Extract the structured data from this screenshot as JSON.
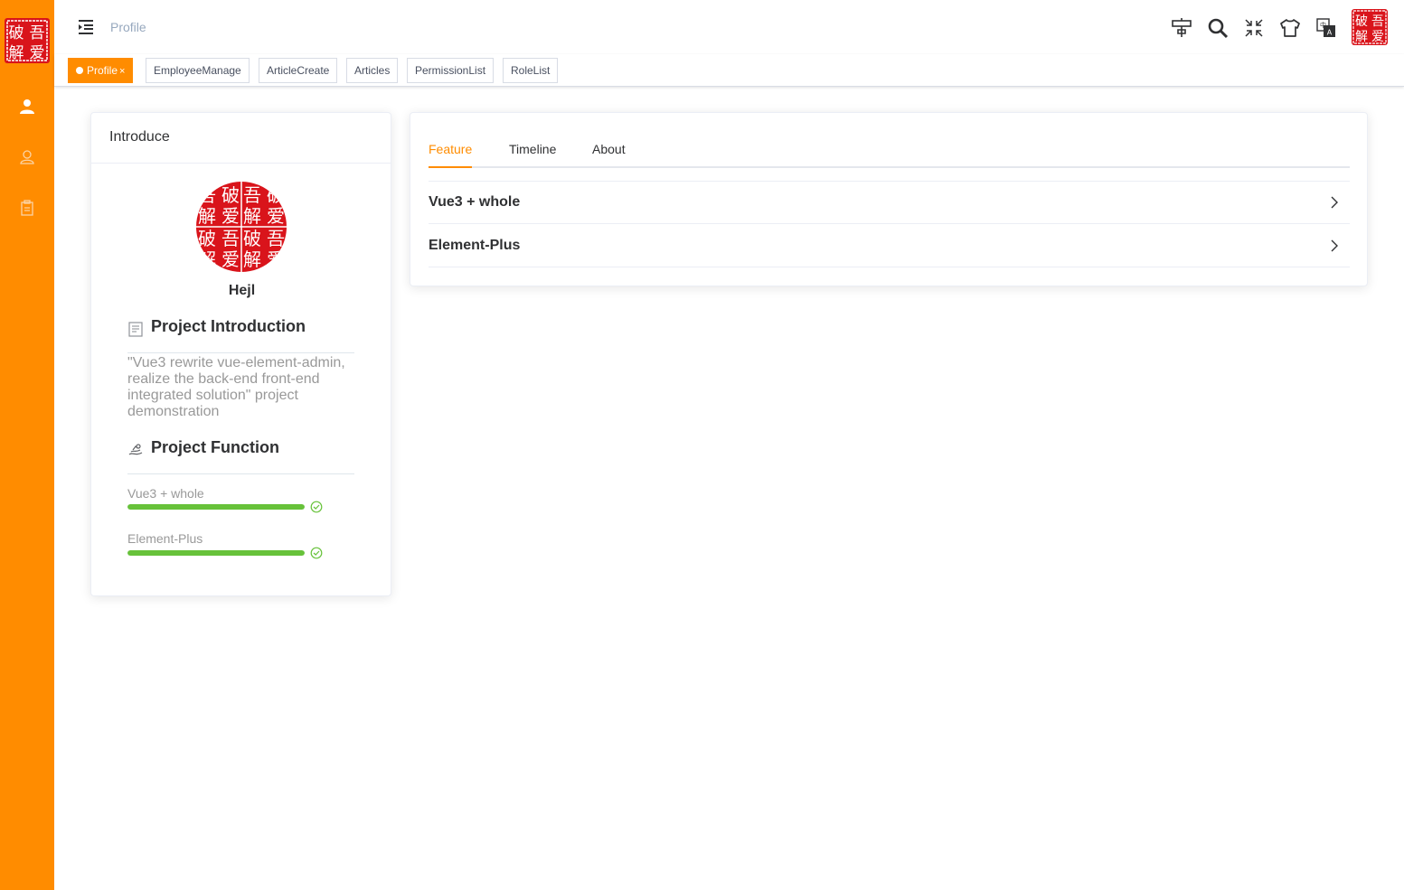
{
  "header": {
    "breadcrumb": "Profile"
  },
  "tags": [
    {
      "label": "Profile",
      "active": true,
      "close": "×"
    },
    {
      "label": "EmployeeManage"
    },
    {
      "label": "ArticleCreate"
    },
    {
      "label": "Articles"
    },
    {
      "label": "PermissionList"
    },
    {
      "label": "RoleList"
    }
  ],
  "sidebar": {
    "items": [
      {
        "icon": "user-icon"
      },
      {
        "icon": "users-icon"
      },
      {
        "icon": "clipboard-icon"
      }
    ]
  },
  "toolbar": {
    "icons": [
      "guide-icon",
      "search-icon",
      "fullscreen-exit-icon",
      "theme-shirt-icon",
      "language-icon",
      "avatar"
    ]
  },
  "profile": {
    "card_title": "Introduce",
    "user_name": "Hejl",
    "intro_title": "Project Introduction",
    "intro_text": "\"Vue3 rewrite vue-element-admin, realize the back-end front-end integrated solution\" project demonstration",
    "function_title": "Project Function",
    "skills": [
      {
        "label": "Vue3 + whole",
        "progress": 100
      },
      {
        "label": "Element-Plus",
        "progress": 100
      }
    ]
  },
  "tabs": [
    {
      "label": "Feature",
      "active": true
    },
    {
      "label": "Timeline"
    },
    {
      "label": "About"
    }
  ],
  "features": [
    {
      "title": "Vue3 + whole"
    },
    {
      "title": "Element-Plus"
    }
  ],
  "colors": {
    "accent": "#ff8c00",
    "success": "#67c23a",
    "seal_red": "#d9141b"
  }
}
